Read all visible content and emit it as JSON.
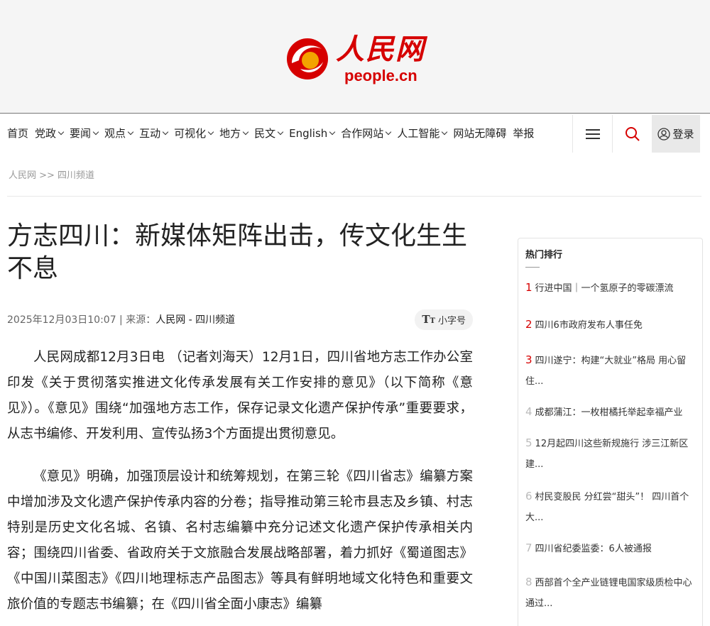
{
  "logo": {
    "cn": "人民网",
    "en": "people.cn"
  },
  "nav": {
    "items": [
      {
        "label": "首页",
        "dropdown": false
      },
      {
        "label": "党政",
        "dropdown": true
      },
      {
        "label": "要闻",
        "dropdown": true
      },
      {
        "label": "观点",
        "dropdown": true
      },
      {
        "label": "互动",
        "dropdown": true
      },
      {
        "label": "可视化",
        "dropdown": true
      },
      {
        "label": "地方",
        "dropdown": true
      },
      {
        "label": "民文",
        "dropdown": true
      },
      {
        "label": "English",
        "dropdown": true
      },
      {
        "label": "合作网站",
        "dropdown": true
      },
      {
        "label": "人工智能",
        "dropdown": true
      },
      {
        "label": "网站无障碍",
        "dropdown": false
      },
      {
        "label": "举报",
        "dropdown": false
      }
    ],
    "login_label": "登录"
  },
  "breadcrumb": "人民网 >> 四川频道",
  "article": {
    "title": "方志四川：新媒体矩阵出击，传文化生生不息",
    "date": "2025年12月03日10:07",
    "source_prefix": " | 来源：",
    "source": "人民网 - 四川频道",
    "font_size_label": "小字号",
    "paragraphs": [
      "人民网成都12月3日电 （记者刘海天）12月1日，四川省地方志工作办公室印发《关于贯彻落实推进文化传承发展有关工作安排的意见》（以下简称《意见》）。《意见》围绕“加强地方志工作，保存记录文化遗产保护传承”重要要求，从志书编修、开发利用、宣传弘扬3个方面提出贯彻意见。",
      "《意见》明确，加强顶层设计和统筹规划，在第三轮《四川省志》编纂方案中增加涉及文化遗产保护传承内容的分卷；指导推动第三轮市县志及乡镇、村志特别是历史文化名城、名镇、名村志编纂中充分记述文化遗产保护传承相关内容；围绕四川省委、省政府关于文旅融合发展战略部署，着力抓好《蜀道图志》《中国川菜图志》《四川地理标志产品图志》等具有鲜明地域文化特色和重要文旅价值的专题志书编纂；在《四川省全面小康志》编纂"
    ]
  },
  "sidebar": {
    "title": "热门排行",
    "items": [
      {
        "num": "1",
        "text": "行进中国｜一个氢原子的零碳漂流"
      },
      {
        "num": "2",
        "text": "四川6市政府发布人事任免"
      },
      {
        "num": "3",
        "text": "四川遂宁：构建“大就业”格局 用心留住..."
      },
      {
        "num": "4",
        "text": "成都蒲江：一枚柑橘托举起幸福产业"
      },
      {
        "num": "5",
        "text": "12月起四川这些新规施行 涉三江新区建..."
      },
      {
        "num": "6",
        "text": "村民变股民 分红尝“甜头”！ 四川首个大..."
      },
      {
        "num": "7",
        "text": "四川省纪委监委：6人被通报"
      },
      {
        "num": "8",
        "text": "西部首个全产业链锂电国家级质检中心通过..."
      }
    ]
  }
}
